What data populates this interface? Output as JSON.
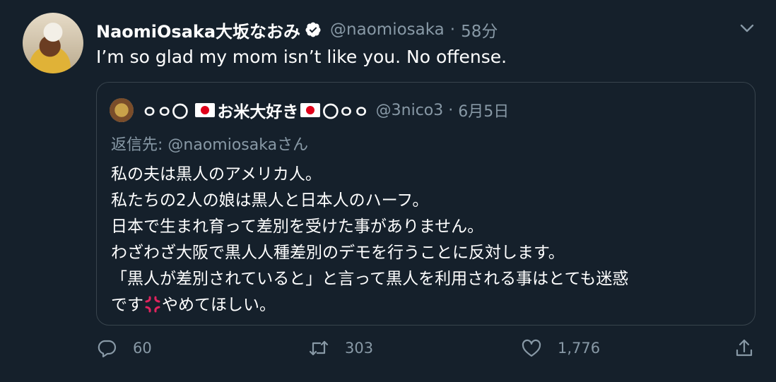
{
  "tweet": {
    "author_name": "NaomiOsaka大坂なおみ",
    "handle": "@naomiosaka",
    "separator": "·",
    "time": "58分",
    "text": "I’m so glad my mom isn’t like you. No offense."
  },
  "quote": {
    "name_part1": "ㅇㅇ〇",
    "name_part2": "お米大好き",
    "name_part3": "〇ㅇㅇ",
    "handle": "@3nico3",
    "separator": "·",
    "date": "6月5日",
    "reply_prefix": "返信先: ",
    "reply_mention": "@naomiosaka",
    "reply_suffix": "さん",
    "lines": [
      "私の夫は黒人のアメリカ人。",
      "私たちの2人の娘は黒人と日本人のハーフ。",
      "日本で生まれ育って差別を受けた事がありません。",
      "わざわざ大阪で黒人人種差別のデモを行うことに反対します。",
      "「黒人が差別されていると」と言って黒人を利用される事はとても迷惑"
    ],
    "last_line_start": "です",
    "last_line_end": "やめてほしい。"
  },
  "actions": {
    "reply_count": "60",
    "retweet_count": "303",
    "like_count": "1,776"
  },
  "colors": {
    "background": "#15202b",
    "secondary_text": "#8899a6",
    "border": "#38444d",
    "verified": "#ffffff"
  },
  "icons": [
    "verified-icon",
    "chevron-down-icon",
    "flag-icon",
    "anger-symbol-icon",
    "reply-icon",
    "retweet-icon",
    "like-icon",
    "share-icon"
  ]
}
